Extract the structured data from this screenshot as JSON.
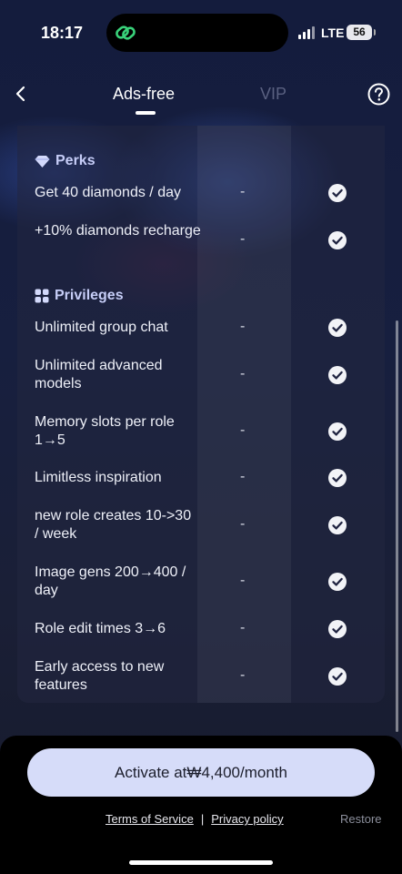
{
  "status_bar": {
    "time": "18:17",
    "network": "LTE",
    "battery": "56"
  },
  "header": {
    "tabs": [
      {
        "label": "Ads-free",
        "selected": true
      },
      {
        "label": "VIP",
        "selected": false
      }
    ]
  },
  "sections": {
    "perks": {
      "title": "Perks",
      "rows": [
        {
          "label": "Get 40 diamonds / day",
          "ads_free": "-",
          "vip": "check"
        },
        {
          "label": "+10% diamonds recharge",
          "ads_free": "-",
          "vip": "check"
        }
      ]
    },
    "privileges": {
      "title": "Privileges",
      "rows": [
        {
          "label": "Unlimited group chat",
          "ads_free": "-",
          "vip": "check"
        },
        {
          "label": "Unlimited advanced models",
          "ads_free": "-",
          "vip": "check"
        },
        {
          "label": "Memory slots per role 1→5",
          "ads_free": "-",
          "vip": "check"
        },
        {
          "label": "Limitless inspiration",
          "ads_free": "-",
          "vip": "check"
        },
        {
          "label": "new role creates 10->30 / week",
          "ads_free": "-",
          "vip": "check"
        },
        {
          "label": "Image gens 200→400 / day",
          "ads_free": "-",
          "vip": "check"
        },
        {
          "label": "Role edit times 3→6",
          "ads_free": "-",
          "vip": "check"
        },
        {
          "label": "Early access to new features",
          "ads_free": "-",
          "vip": "check"
        }
      ]
    }
  },
  "footer": {
    "activate_label": "Activate at₩4,400/month",
    "terms_label": "Terms of Service",
    "separator": "|",
    "privacy_label": "Privacy policy",
    "restore_label": "Restore"
  },
  "colors": {
    "accent_button": "#d6dcf9",
    "section_title": "#c6cdf7",
    "inactive_tab": "#5a6181"
  }
}
